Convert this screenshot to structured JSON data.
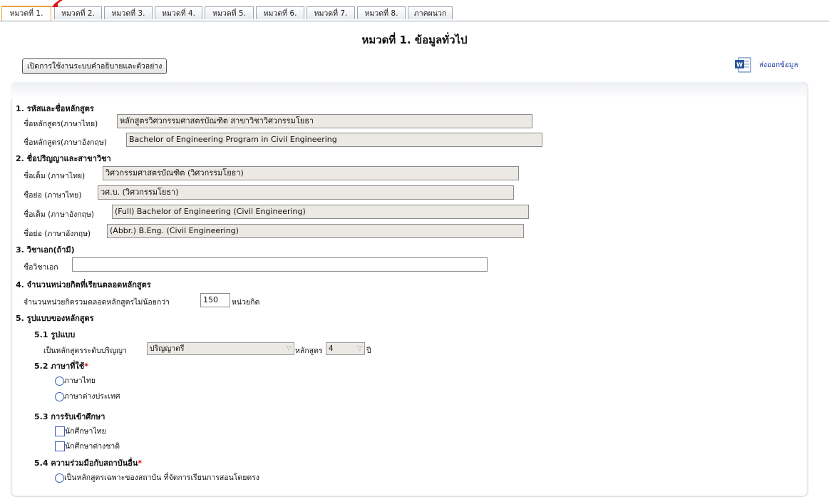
{
  "tabs": [
    "หมวดที่ 1.",
    "หมวดที่ 2.",
    "หมวดที่ 3.",
    "หมวดที่ 4.",
    "หมวดที่ 5.",
    "หมวดที่ 6.",
    "หมวดที่ 7.",
    "หมวดที่ 8.",
    "ภาคผนวก"
  ],
  "page_title": "หมวดที่ 1. ข้อมูลทั่วไป",
  "help_button": "เปิดการใช้งานระบบคำอธิบายและตัวอย่าง",
  "export_label": "ส่งออกข้อมูล",
  "s1": {
    "title": "1. รหัสและชื่อหลักสูตร",
    "name_th_label": "ชื่อหลักสูตร(ภาษาไทย)",
    "name_th_value": "หลักสูตรวิศวกรรมศาสตรบัณฑิต สาขาวิชาวิศวกรรมโยธา",
    "name_en_label": "ชื่อหลักสูตร(ภาษาอังกฤษ)",
    "name_en_value": "Bachelor of Engineering Program in Civil Engineering"
  },
  "s2": {
    "title": "2. ชื่อปริญญาและสาขาวิชา",
    "full_th_label": "ชื่อเต็ม (ภาษาไทย)",
    "full_th_value": "วิศวกรรมศาสตรบัณฑิต (วิศวกรรมโยธา)",
    "abbr_th_label": "ชื่อย่อ (ภาษาไทย)",
    "abbr_th_value": "วศ.บ. (วิศวกรรมโยธา)",
    "full_en_label": "ชื่อเต็ม (ภาษาอังกฤษ)",
    "full_en_value": "(Full) Bachelor of Engineering (Civil Engineering)",
    "abbr_en_label": "ชื่อย่อ (ภาษาอังกฤษ)",
    "abbr_en_value": "(Abbr.) B.Eng. (Civil Engineering)"
  },
  "s3": {
    "title": "3. วิชาเอก(ถ้ามี)",
    "major_label": "ชื่อวิชาเอก",
    "major_value": ""
  },
  "s4": {
    "title": "4. จำนวนหน่วยกิตที่เรียนตลอดหลักสูตร",
    "credits_label": "จำนวนหน่วยกิตรวมตลอดหลักสูตรไม่น้อยกว่า",
    "credits_value": "150",
    "credits_unit": "หน่วยกิต"
  },
  "s5": {
    "title": "5. รูปแบบของหลักสูตร",
    "s51_title": "5.1 รูปแบบ",
    "degree_label": "เป็นหลักสูตรระดับปริญญา",
    "degree_value": "ปริญญาตรี",
    "years_label": "หลักสูตร",
    "years_value": "4",
    "years_unit": "ปี",
    "s52_title": "5.2 ภาษาที่ใช้",
    "lang_opt1": "ภาษาไทย",
    "lang_opt2": "ภาษาต่างประเทศ",
    "s53_title": "5.3 การรับเข้าศึกษา",
    "adm_opt1": "นักศึกษาไทย",
    "adm_opt2": "นักศึกษาต่างชาติ",
    "s54_title": "5.4 ความร่วมมือกับสถาบันอื่น",
    "coop_opt1": "เป็นหลักสูตรเฉพาะของสถาบัน ที่จัดการเรียนการสอนโดยตรง"
  },
  "required_mark": "*",
  "dropdown_chevron": "▽"
}
